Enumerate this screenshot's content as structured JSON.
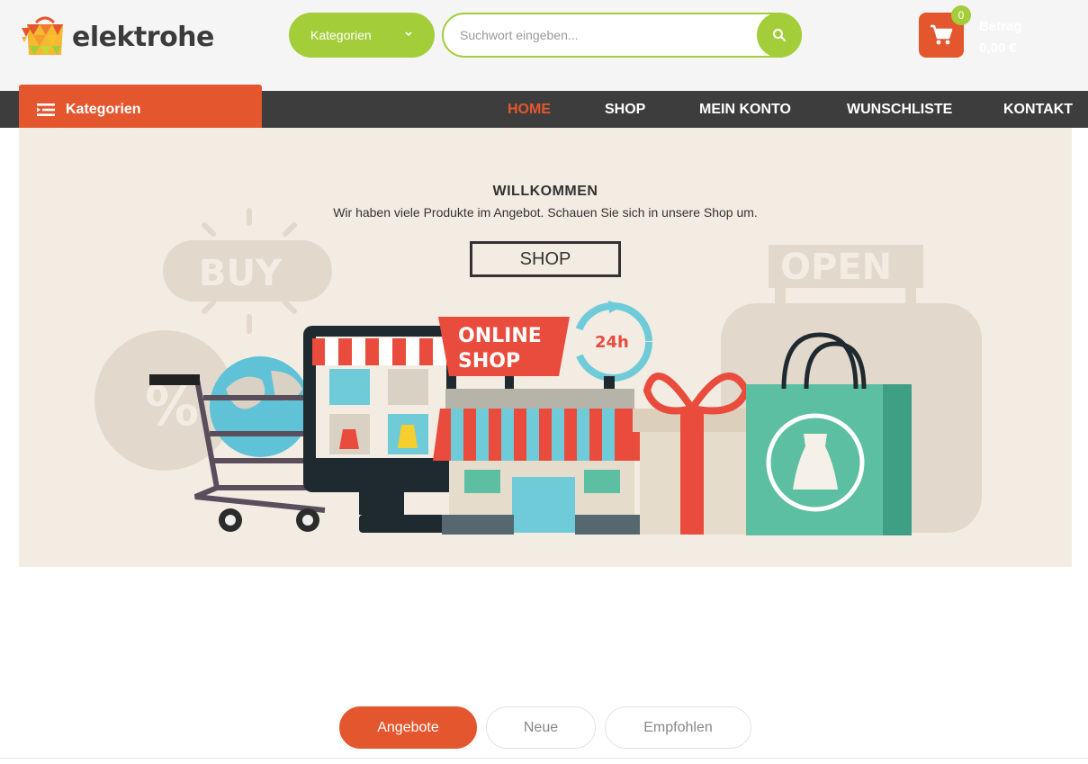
{
  "header": {
    "logo_text": "elektrohe",
    "category_select": "Kategorien",
    "search_placeholder": "Suchwort eingeben...",
    "cart": {
      "count": "0",
      "label": "Betrag",
      "amount": "0,00 €"
    }
  },
  "nav": {
    "categories_label": "Kategorien",
    "links": [
      "HOME",
      "SHOP",
      "MEIN KONTO",
      "WUNSCHLISTE",
      "KONTAKT"
    ],
    "active": "HOME"
  },
  "hero": {
    "title": "WILLKOMMEN",
    "subtitle": "Wir haben viele Produkte im Angebot. Schauen Sie sich in unsere Shop um.",
    "button": "SHOP",
    "art_text": {
      "buy": "BUY",
      "open": "OPEN",
      "online": "ONLINE",
      "shop": "SHOP",
      "hours": "24h",
      "percent": "%"
    }
  },
  "tabs": [
    "Angebote",
    "Neue",
    "Empfohlen"
  ],
  "colors": {
    "accent": "#e4572e",
    "green": "#a3cd39",
    "dark": "#3d3d3d",
    "hero_bg": "#f3ece3"
  }
}
